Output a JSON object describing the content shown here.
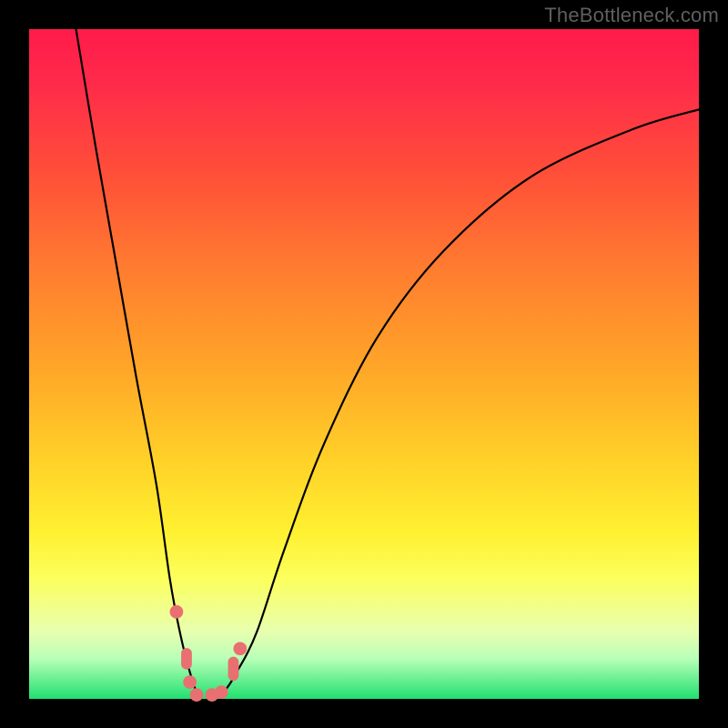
{
  "watermark": "TheBottleneck.com",
  "chart_data": {
    "type": "line",
    "title": "",
    "xlabel": "",
    "ylabel": "",
    "xlim": [
      0,
      100
    ],
    "ylim": [
      0,
      100
    ],
    "series": [
      {
        "name": "curve",
        "x": [
          7,
          10,
          13,
          16,
          19,
          21,
          22.5,
          24,
          25.5,
          27,
          29,
          31,
          34,
          38,
          44,
          52,
          62,
          75,
          90,
          100
        ],
        "y": [
          100,
          82,
          65,
          48,
          32,
          18,
          10,
          4,
          0,
          0,
          1,
          4,
          10,
          22,
          38,
          54,
          67,
          78,
          85,
          88
        ]
      }
    ],
    "markers": [
      {
        "x": 22.0,
        "y": 13.0,
        "kind": "dot",
        "r": 1.0
      },
      {
        "x": 23.5,
        "y": 6.0,
        "kind": "pill",
        "w": 1.6,
        "h": 3.2
      },
      {
        "x": 24.0,
        "y": 2.5,
        "kind": "dot",
        "r": 1.0
      },
      {
        "x": 25.0,
        "y": 0.6,
        "kind": "dot",
        "r": 1.0
      },
      {
        "x": 27.3,
        "y": 0.6,
        "kind": "dot",
        "r": 1.0
      },
      {
        "x": 28.7,
        "y": 1.0,
        "kind": "dot",
        "r": 1.0
      },
      {
        "x": 30.5,
        "y": 4.5,
        "kind": "pill",
        "w": 1.6,
        "h": 3.6
      },
      {
        "x": 31.5,
        "y": 7.5,
        "kind": "dot",
        "r": 1.0
      }
    ],
    "gradient_stops": [
      {
        "pos": 0,
        "color": "#ff1b4a"
      },
      {
        "pos": 35,
        "color": "#ff7a30"
      },
      {
        "pos": 64,
        "color": "#ffd028"
      },
      {
        "pos": 82,
        "color": "#fcff5c"
      },
      {
        "pos": 100,
        "color": "#20e070"
      }
    ]
  }
}
